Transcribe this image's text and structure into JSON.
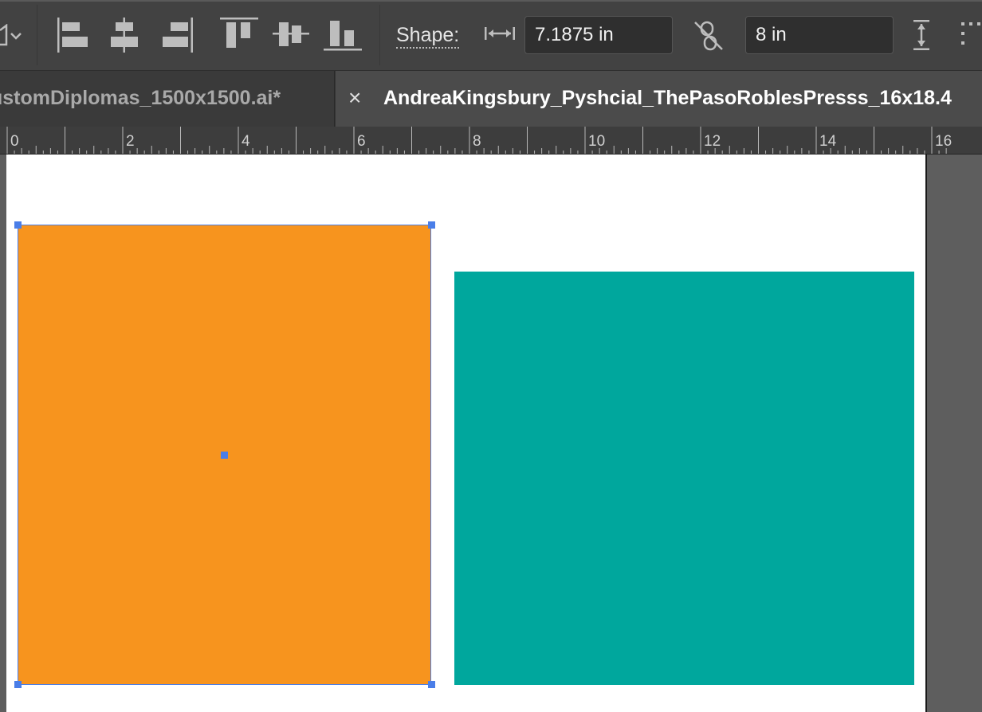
{
  "toolbar": {
    "shape_label": "Shape:",
    "width_value": "7.1875 in",
    "height_value": "8 in",
    "icons": [
      "shape-dropdown-icon",
      "align-left-icon",
      "align-horizontal-center-icon",
      "align-right-icon",
      "align-top-icon",
      "align-vertical-center-icon",
      "align-bottom-icon",
      "width-arrow-icon",
      "unlink-proportions-icon",
      "height-arrow-icon",
      "more-options-icon"
    ]
  },
  "tabs": [
    {
      "label": "ustomDiplomas_1500x1500.ai*",
      "active": false
    },
    {
      "label": "AndreaKingsbury_Pyshcial_ThePasoRoblesPresss_16x18.4",
      "active": true,
      "close": "×"
    }
  ],
  "ruler": {
    "labels": [
      "0",
      "2",
      "4",
      "6",
      "8",
      "10",
      "12",
      "14",
      "16"
    ]
  },
  "canvas": {
    "shapes": [
      {
        "name": "orange-rectangle",
        "fill": "#F7941E",
        "selected": true
      },
      {
        "name": "teal-rectangle",
        "fill": "#00A79D",
        "selected": false
      }
    ],
    "selection_color": "#4A7EE8"
  }
}
